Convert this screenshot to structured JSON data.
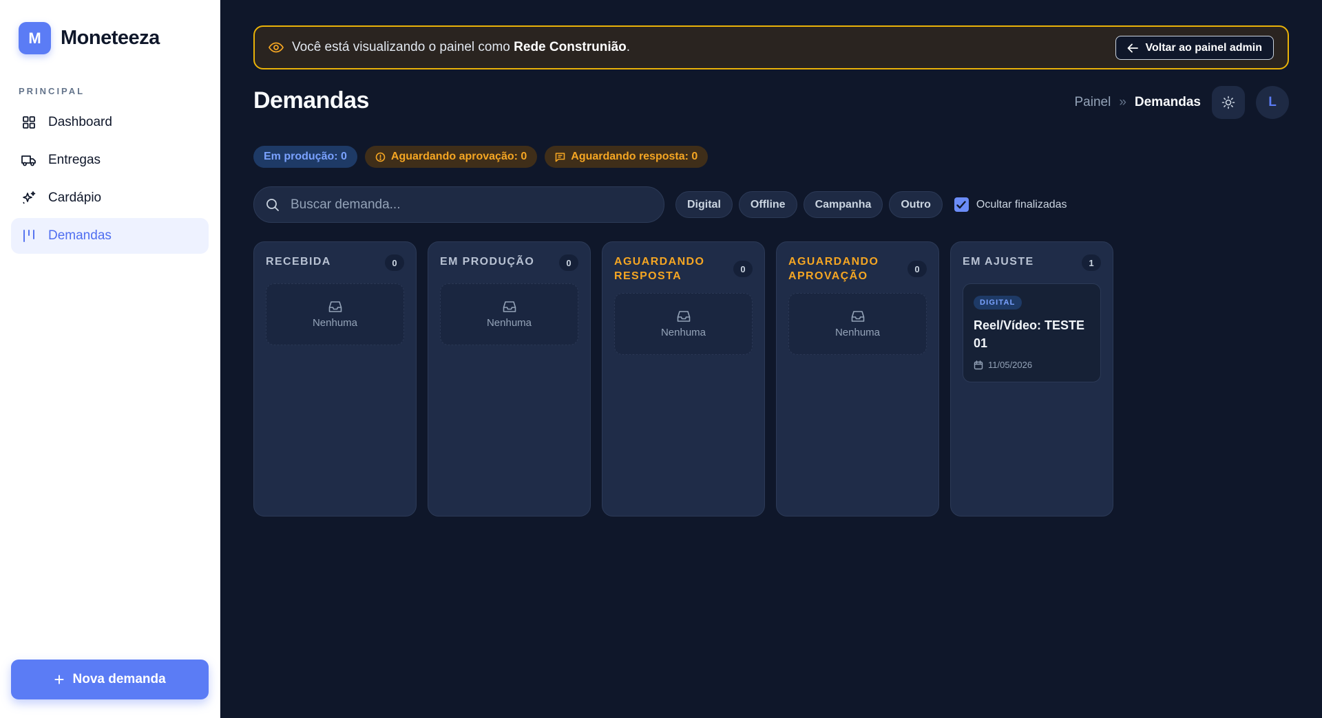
{
  "brand": {
    "logo_letter": "M",
    "name": "Moneteeza"
  },
  "sidebar": {
    "section_label": "PRINCIPAL",
    "items": [
      {
        "label": "Dashboard",
        "icon": "grid-icon"
      },
      {
        "label": "Entregas",
        "icon": "truck-icon"
      },
      {
        "label": "Cardápio",
        "icon": "sparkles-icon"
      },
      {
        "label": "Demandas",
        "icon": "kanban-icon",
        "active": true
      }
    ],
    "new_button": {
      "plus": "+",
      "label": "Nova demanda"
    }
  },
  "banner": {
    "prefix": "Você está visualizando o painel como ",
    "entity": "Rede Construnião",
    "suffix": ".",
    "back_label": "Voltar ao painel admin"
  },
  "header": {
    "title": "Demandas",
    "breadcrumb": {
      "home": "Painel",
      "separator": "»",
      "current": "Demandas"
    },
    "avatar_letter": "L"
  },
  "chips": {
    "producao": "Em produção: 0",
    "aprovacao": "Aguardando aprovação: 0",
    "resposta": "Aguardando resposta: 0"
  },
  "search": {
    "placeholder": "Buscar demanda..."
  },
  "filters": {
    "digital": "Digital",
    "offline": "Offline",
    "campanha": "Campanha",
    "outro": "Outro",
    "hide_finished": {
      "label": "Ocultar finalizadas",
      "checked": true
    }
  },
  "board": {
    "columns": [
      {
        "title": "RECEBIDA",
        "count": "0",
        "empty_label": "Nenhuma"
      },
      {
        "title": "EM PRODUÇÃO",
        "count": "0",
        "empty_label": "Nenhuma"
      },
      {
        "title": "AGUARDANDO RESPOSTA",
        "count": "0",
        "empty_label": "Nenhuma"
      },
      {
        "title": "AGUARDANDO APROVAÇÃO",
        "count": "0",
        "empty_label": "Nenhuma"
      },
      {
        "title": "EM AJUSTE",
        "count": "1",
        "cards": [
          {
            "tag": "DIGITAL",
            "title": "Reel/Vídeo: TESTE 01",
            "date": "11/05/2026"
          }
        ]
      }
    ]
  },
  "colors": {
    "accent": "#5b7cf5",
    "amber": "#f5a623",
    "bg": "#0f172a",
    "column_bg": "#1f2c48"
  }
}
